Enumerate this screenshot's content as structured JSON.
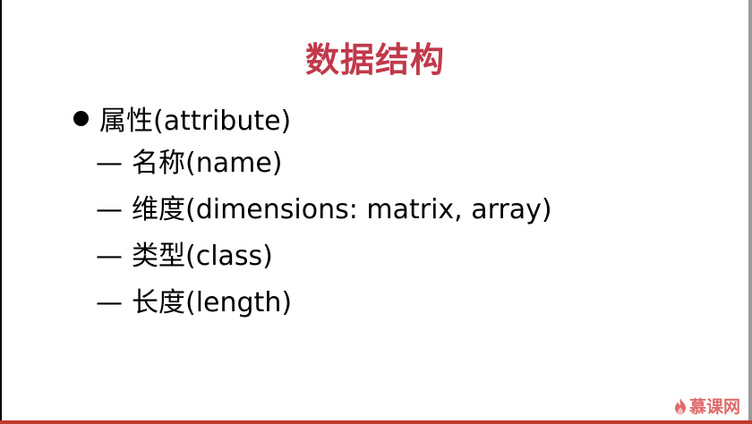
{
  "slide": {
    "title": "数据结构",
    "bullet": "属性(attribute)",
    "dash_symbol": "—",
    "items": [
      {
        "text": "名称(name)"
      },
      {
        "text": "维度(dimensions: matrix, array)"
      },
      {
        "text": "类型(class)"
      },
      {
        "text": "长度(length)"
      }
    ]
  },
  "watermark": {
    "text": "慕课网",
    "icon": "flame-icon"
  },
  "colors": {
    "title": "#c0394b",
    "accent_bar": "#c0392b",
    "watermark": "#e06a6a"
  }
}
